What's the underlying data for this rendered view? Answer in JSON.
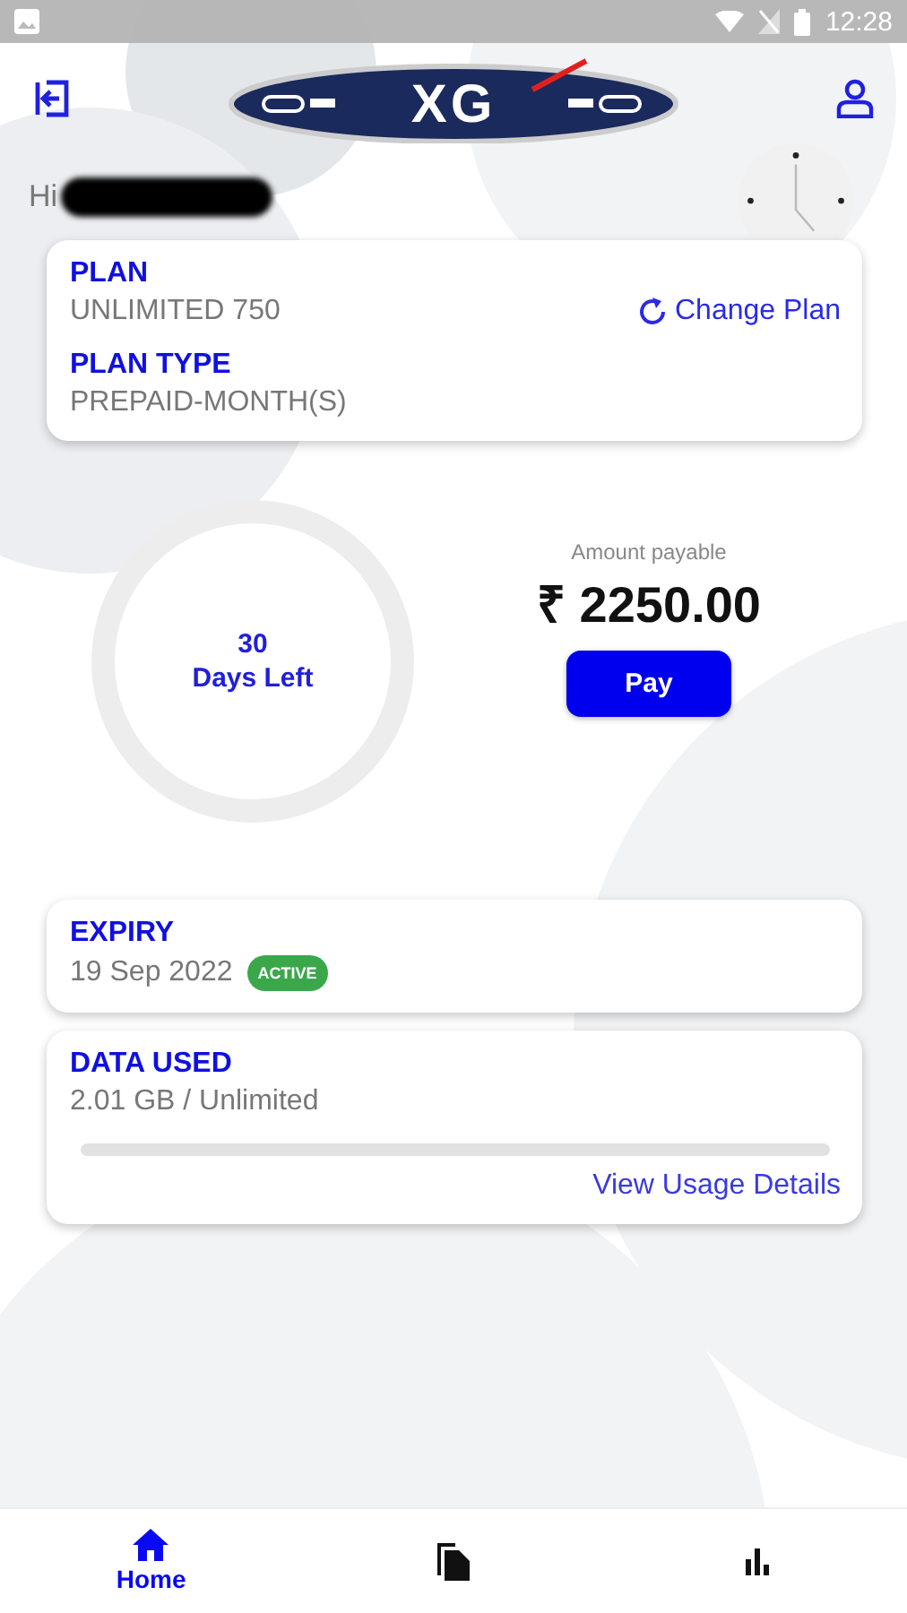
{
  "status_bar": {
    "time": "12:28"
  },
  "header": {
    "logo": "XG"
  },
  "greeting": {
    "text": "Hi"
  },
  "plan_card": {
    "plan_label": "PLAN",
    "plan": "UNLIMITED 750",
    "change_plan": "Change Plan",
    "type_label": "PLAN TYPE",
    "type": "PREPAID-MONTH(S)"
  },
  "days": {
    "count": "30",
    "label": "Days Left"
  },
  "payment": {
    "label": "Amount payable",
    "amount": "₹ 2250.00",
    "button": "Pay"
  },
  "expiry_card": {
    "label": "EXPIRY",
    "date": "19 Sep 2022",
    "status": "ACTIVE"
  },
  "data_card": {
    "label": "DATA USED",
    "usage": "2.01 GB / Unlimited",
    "level": 0,
    "link": "View Usage Details"
  },
  "bottom_nav": [
    {
      "kind": "home",
      "label": "Home",
      "selected": true
    },
    {
      "kind": "documents",
      "selected": false
    },
    {
      "kind": "chart",
      "selected": false
    }
  ]
}
